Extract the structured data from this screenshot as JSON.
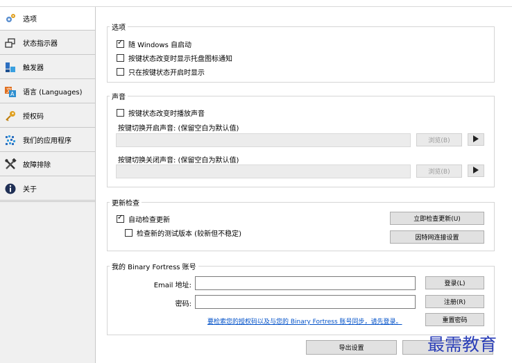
{
  "window": {
    "title": ""
  },
  "sidebar": {
    "items": [
      {
        "label": "选项",
        "icon": "gear-icon"
      },
      {
        "label": "状态指示器",
        "icon": "windows-icon"
      },
      {
        "label": "触发器",
        "icon": "trigger-icon"
      },
      {
        "label": "语言 (Languages)",
        "icon": "language-icon"
      },
      {
        "label": "授权码",
        "icon": "key-icon"
      },
      {
        "label": "我们的应用程序",
        "icon": "apps-icon"
      },
      {
        "label": "故障排除",
        "icon": "tools-icon"
      },
      {
        "label": "关于",
        "icon": "info-icon"
      }
    ]
  },
  "options": {
    "title": "选项",
    "start_with_windows": {
      "label": "随 Windows 自启动",
      "checked": true
    },
    "tray_notification": {
      "label": "按键状态改变时显示托盘图标通知",
      "checked": false
    },
    "show_only_on": {
      "label": "只在按键状态开启时显示",
      "checked": false
    }
  },
  "sound": {
    "title": "声音",
    "play_sound": {
      "label": "按键状态改变时播放声音",
      "checked": false
    },
    "on_label": "按键切换开启声音: (保留空白为默认值)",
    "off_label": "按键切换关闭声音: (保留空白为默认值)",
    "browse_label": "浏览(B)"
  },
  "updates": {
    "title": "更新检查",
    "auto_check": {
      "label": "自动检查更新",
      "checked": true
    },
    "beta_check": {
      "label": "检查新的测试版本 (较新但不稳定)",
      "checked": false
    },
    "check_now_label": "立即检查更新(U)",
    "internet_settings_label": "因特网连接设置"
  },
  "account": {
    "title": "我的 Binary Fortress 账号",
    "email_label": "Email 地址:",
    "password_label": "密码:",
    "email_value": "",
    "password_value": "",
    "login_label": "登录(L)",
    "register_label": "注册(R)",
    "reset_label": "重置密码",
    "sync_link": "要检索您的授权码以及与您的 Binary Fortress 账号同步，请先登录。"
  },
  "footer": {
    "export_label": "导出设置",
    "import_label": ""
  },
  "watermark": "最需教育",
  "colors": {
    "link": "#0050c8",
    "watermark": "#2b3fb8"
  }
}
